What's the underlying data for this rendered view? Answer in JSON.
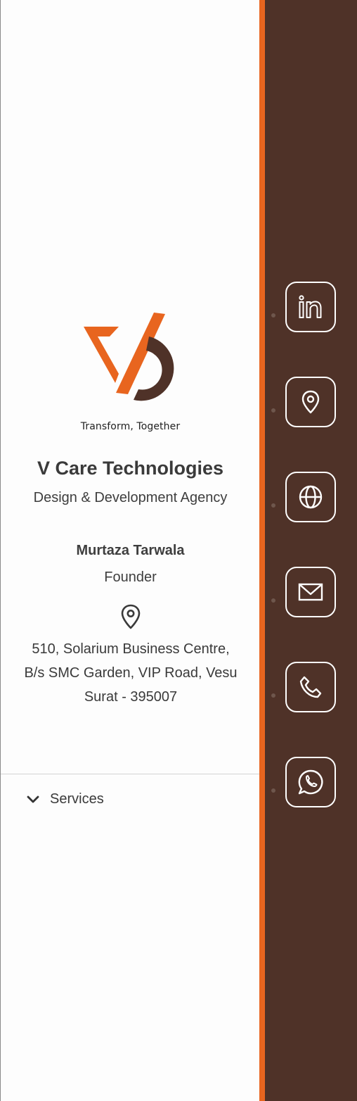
{
  "brand": {
    "tagline": "Transform, Together",
    "colors": {
      "orange": "#e8651f",
      "brown": "#4f3228"
    }
  },
  "card": {
    "company": "V Care Technologies",
    "subtitle": "Design & Development Agency",
    "person": "Murtaza Tarwala",
    "role": "Founder",
    "address_lines": [
      "510, Solarium Business Centre,",
      "B/s SMC Garden, VIP Road, Vesu",
      "Surat - 395007"
    ]
  },
  "services": {
    "label": "Services"
  },
  "sidebar_icons": [
    "linkedin-icon",
    "location-icon",
    "globe-icon",
    "mail-icon",
    "phone-icon",
    "whatsapp-icon"
  ]
}
